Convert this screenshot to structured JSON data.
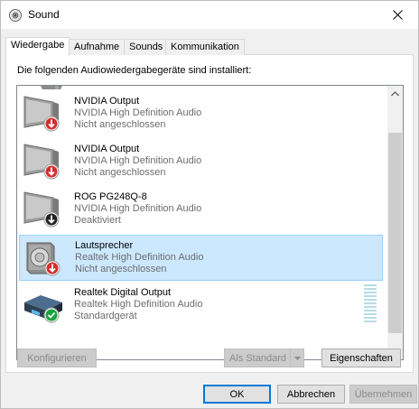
{
  "window": {
    "title": "Sound"
  },
  "tabs": [
    {
      "label": "Wiedergabe",
      "active": true
    },
    {
      "label": "Aufnahme",
      "active": false
    },
    {
      "label": "Sounds",
      "active": false
    },
    {
      "label": "Kommunikation",
      "active": false
    }
  ],
  "panel": {
    "label": "Die folgenden Audiowiedergabegeräte sind installiert:"
  },
  "devices": [
    {
      "name": "NVIDIA Output",
      "driver": "NVIDIA High Definition Audio",
      "status": "Nicht angeschlossen",
      "icon": "monitor-icon",
      "badge": "red-down-arrow-badge",
      "selected": false
    },
    {
      "name": "NVIDIA Output",
      "driver": "NVIDIA High Definition Audio",
      "status": "Nicht angeschlossen",
      "icon": "monitor-icon",
      "badge": "red-down-arrow-badge",
      "selected": false
    },
    {
      "name": "ROG PG248Q-8",
      "driver": "NVIDIA High Definition Audio",
      "status": "Deaktiviert",
      "icon": "monitor-icon",
      "badge": "black-down-arrow-badge",
      "selected": false
    },
    {
      "name": "Lautsprecher",
      "driver": "Realtek High Definition Audio",
      "status": "Nicht angeschlossen",
      "icon": "speaker-icon",
      "badge": "red-down-arrow-badge",
      "selected": true
    },
    {
      "name": "Realtek Digital Output",
      "driver": "Realtek High Definition Audio",
      "status": "Standardgerät",
      "icon": "digital-output-icon",
      "badge": "green-check-badge",
      "selected": false
    }
  ],
  "buttons": {
    "configure": "Konfigurieren",
    "set_default": "Als Standard",
    "properties": "Eigenschaften",
    "ok": "OK",
    "cancel": "Abbrechen",
    "apply": "Übernehmen"
  },
  "colors": {
    "selection_bg": "#cce8ff",
    "selection_border": "#99d1ff",
    "status_red": "#d32f2f",
    "status_green": "#14a53c",
    "focus_blue": "#0078d7"
  }
}
